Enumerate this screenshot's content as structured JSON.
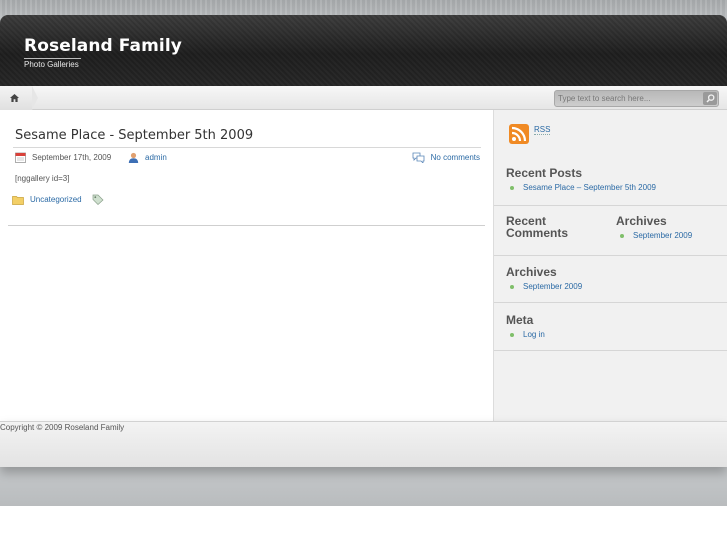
{
  "header": {
    "site_title": "Roseland Family",
    "site_description": "Photo Galleries"
  },
  "nav": {
    "home_icon": "home-icon",
    "search_placeholder": "Type text to search here..."
  },
  "post": {
    "title": "Sesame Place - September 5th 2009",
    "date": "September 17th, 2009",
    "author": "admin",
    "comments": "No comments",
    "body": "[nggallery id=3]",
    "category": "Uncategorized"
  },
  "sidebar": {
    "rss_label": "RSS",
    "recent_posts": {
      "title": "Recent Posts",
      "items": [
        "Sesame Place – September 5th 2009"
      ]
    },
    "recent_comments": {
      "title_line1": "Recent",
      "title_line2": "Comments"
    },
    "archives_inline": {
      "title": "Archives",
      "items": [
        "September 2009"
      ]
    },
    "archives": {
      "title": "Archives",
      "items": [
        "September 2009"
      ]
    },
    "meta": {
      "title": "Meta",
      "items": [
        "Log in"
      ]
    }
  },
  "footer": {
    "copyright": "Copyright © 2009 Roseland Family"
  },
  "colors": {
    "link": "#2b6aa5",
    "bullet": "#7fbf6a",
    "header_dark": "#1e1e1e",
    "rss_orange": "#f08a24"
  }
}
